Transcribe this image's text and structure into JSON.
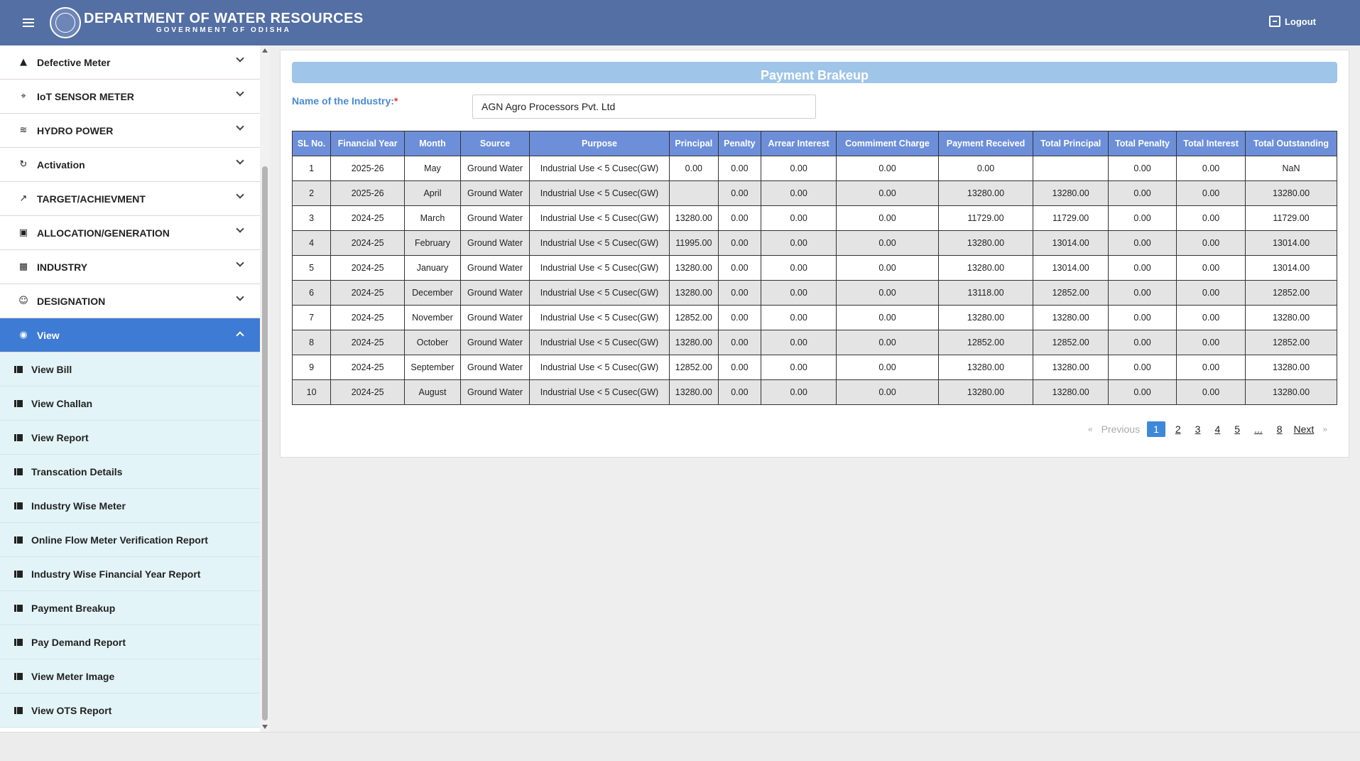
{
  "header": {
    "title": "DEPARTMENT OF WATER RESOURCES",
    "subtitle": "GOVERNMENT OF ODISHA",
    "logout_label": "Logout"
  },
  "sidebar": {
    "items": [
      {
        "label": "Defective Meter",
        "icon": "warning-icon",
        "glyph": "▲"
      },
      {
        "label": "IoT SENSOR METER",
        "icon": "sensor-icon",
        "glyph": "⌖"
      },
      {
        "label": "HYDRO POWER",
        "icon": "waves-icon",
        "glyph": "≋"
      },
      {
        "label": "Activation",
        "icon": "refresh-icon",
        "glyph": "↻"
      },
      {
        "label": "TARGET/ACHIEVMENT",
        "icon": "trend-icon",
        "glyph": "↗"
      },
      {
        "label": "ALLOCATION/GENERATION",
        "icon": "document-icon",
        "glyph": "▣"
      },
      {
        "label": "INDUSTRY",
        "icon": "building-icon",
        "glyph": "▦"
      },
      {
        "label": "DESIGNATION",
        "icon": "person-icon",
        "glyph": "☺"
      },
      {
        "label": "View",
        "icon": "eye-icon",
        "glyph": "◉",
        "active": true
      }
    ],
    "subitems": [
      "View Bill",
      "View Challan",
      "View Report",
      "Transcation Details",
      "Industry Wise Meter",
      "Online Flow Meter Verification Report",
      "Industry Wise Financial Year Report",
      "Payment Breakup",
      "Pay Demand Report",
      "View Meter Image",
      "View OTS Report"
    ]
  },
  "main": {
    "title": "Payment Brakeup",
    "industry_label": "Name of the Industry:",
    "industry_required": "*",
    "industry_value": "AGN Agro Processors Pvt. Ltd",
    "table": {
      "headers": [
        "SL No.",
        "Financial Year",
        "Month",
        "Source",
        "Purpose",
        "Principal",
        "Penalty",
        "Arrear Interest",
        "Commiment Charge",
        "Payment Received",
        "Total Principal",
        "Total Penalty",
        "Total Interest",
        "Total Outstanding"
      ],
      "rows": [
        [
          "1",
          "2025-26",
          "May",
          "Ground Water",
          "Industrial Use < 5 Cusec(GW)",
          "0.00",
          "0.00",
          "0.00",
          "0.00",
          "0.00",
          "",
          "0.00",
          "0.00",
          "NaN"
        ],
        [
          "2",
          "2025-26",
          "April",
          "Ground Water",
          "Industrial Use < 5 Cusec(GW)",
          "",
          "0.00",
          "0.00",
          "0.00",
          "13280.00",
          "13280.00",
          "0.00",
          "0.00",
          "13280.00"
        ],
        [
          "3",
          "2024-25",
          "March",
          "Ground Water",
          "Industrial Use < 5 Cusec(GW)",
          "13280.00",
          "0.00",
          "0.00",
          "0.00",
          "11729.00",
          "11729.00",
          "0.00",
          "0.00",
          "11729.00"
        ],
        [
          "4",
          "2024-25",
          "February",
          "Ground Water",
          "Industrial Use < 5 Cusec(GW)",
          "11995.00",
          "0.00",
          "0.00",
          "0.00",
          "13280.00",
          "13014.00",
          "0.00",
          "0.00",
          "13014.00"
        ],
        [
          "5",
          "2024-25",
          "January",
          "Ground Water",
          "Industrial Use < 5 Cusec(GW)",
          "13280.00",
          "0.00",
          "0.00",
          "0.00",
          "13280.00",
          "13014.00",
          "0.00",
          "0.00",
          "13014.00"
        ],
        [
          "6",
          "2024-25",
          "December",
          "Ground Water",
          "Industrial Use < 5 Cusec(GW)",
          "13280.00",
          "0.00",
          "0.00",
          "0.00",
          "13118.00",
          "12852.00",
          "0.00",
          "0.00",
          "12852.00"
        ],
        [
          "7",
          "2024-25",
          "November",
          "Ground Water",
          "Industrial Use < 5 Cusec(GW)",
          "12852.00",
          "0.00",
          "0.00",
          "0.00",
          "13280.00",
          "13280.00",
          "0.00",
          "0.00",
          "13280.00"
        ],
        [
          "8",
          "2024-25",
          "October",
          "Ground Water",
          "Industrial Use < 5 Cusec(GW)",
          "13280.00",
          "0.00",
          "0.00",
          "0.00",
          "12852.00",
          "12852.00",
          "0.00",
          "0.00",
          "12852.00"
        ],
        [
          "9",
          "2024-25",
          "September",
          "Ground Water",
          "Industrial Use < 5 Cusec(GW)",
          "12852.00",
          "0.00",
          "0.00",
          "0.00",
          "13280.00",
          "13280.00",
          "0.00",
          "0.00",
          "13280.00"
        ],
        [
          "10",
          "2024-25",
          "August",
          "Ground Water",
          "Industrial Use < 5 Cusec(GW)",
          "13280.00",
          "0.00",
          "0.00",
          "0.00",
          "13280.00",
          "13280.00",
          "0.00",
          "0.00",
          "13280.00"
        ]
      ]
    },
    "pagination": {
      "prev_arrow": "«",
      "previous": "Previous",
      "pages": [
        "1",
        "2",
        "3",
        "4",
        "5",
        "...",
        "8"
      ],
      "current": "1",
      "next": "Next",
      "next_arrow": "»"
    }
  },
  "colors": {
    "header": "#536fa4",
    "active_nav": "#3e7bd4",
    "table_header": "#6d8fd9",
    "title_bar": "#9fc5e8",
    "submenu_bg": "#e3f4f8"
  }
}
